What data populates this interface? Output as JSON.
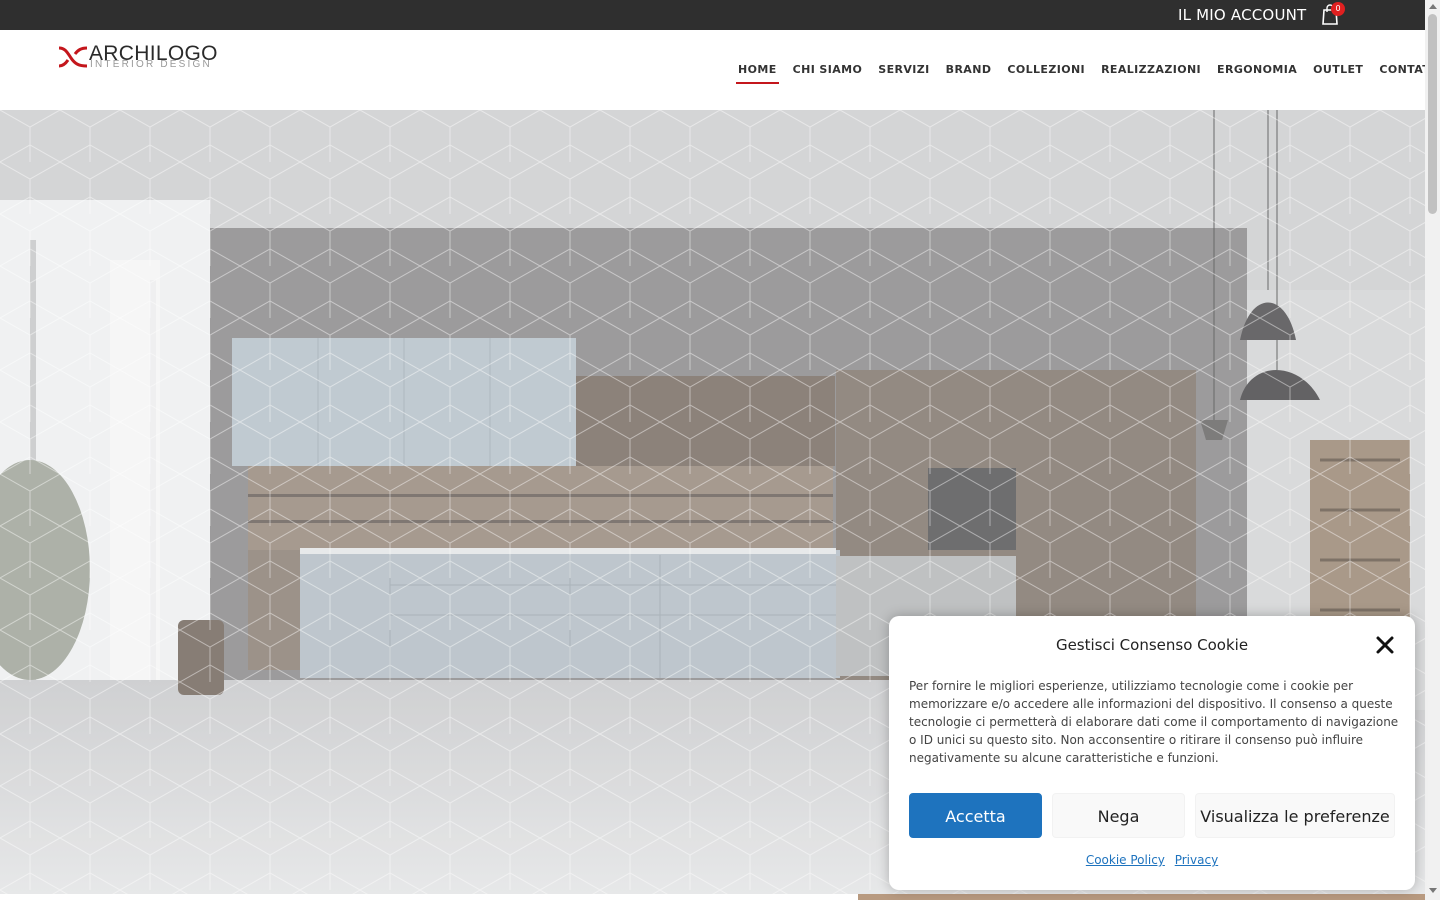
{
  "topbar": {
    "account_label": "IL MIO ACCOUNT",
    "cart_count": "0",
    "background": "#2f2f2f"
  },
  "header": {
    "logo": {
      "name": "ARCHILOGO",
      "tagline": "INTERIOR DESIGN",
      "brand_color": "#c4161c"
    },
    "nav": [
      {
        "label": "HOME",
        "active": true
      },
      {
        "label": "CHI SIAMO"
      },
      {
        "label": "SERVIZI"
      },
      {
        "label": "BRAND"
      },
      {
        "label": "COLLEZIONI"
      },
      {
        "label": "REALIZZAZIONI"
      },
      {
        "label": "ERGONOMIA"
      },
      {
        "label": "OUTLET"
      },
      {
        "label": "CONTATTI"
      }
    ]
  },
  "hero": {
    "image": "kitchen-interior-photo",
    "overlay": "hexagon-pattern"
  },
  "cookie_banner": {
    "title": "Gestisci Consenso Cookie",
    "close_icon": "close-icon",
    "text": "Per fornire le migliori esperienze, utilizziamo tecnologie come i cookie per memorizzare e/o accedere alle informazioni del dispositivo. Il consenso a queste tecnologie ci permetterà di elaborare dati come il comportamento di navigazione o ID unici su questo sito. Non acconsentire o ritirare il consenso può influire negativamente su alcune caratteristiche e funzioni.",
    "accept_label": "Accetta",
    "deny_label": "Nega",
    "preferences_label": "Visualizza le preferenze",
    "links": [
      "Cookie Policy",
      "Privacy"
    ],
    "accent_color": "#1e73be"
  }
}
